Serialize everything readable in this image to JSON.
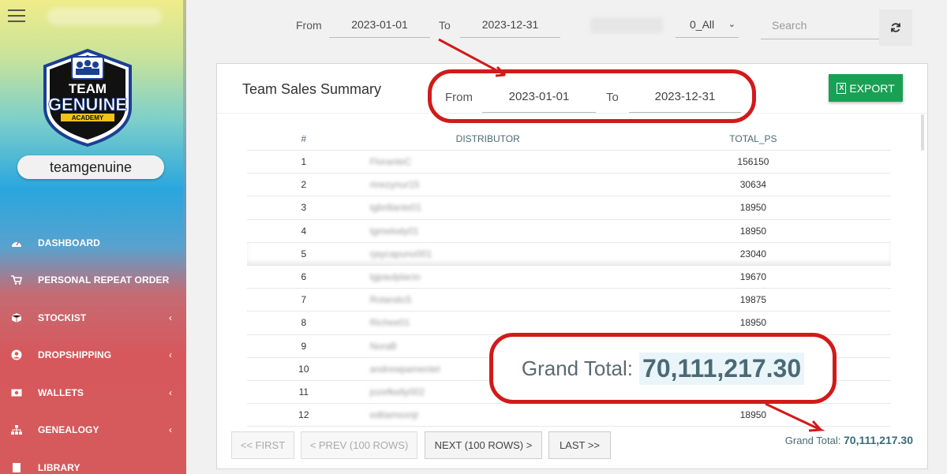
{
  "sidebar": {
    "username": "teamgenuine",
    "logo": {
      "line1": "TEAM",
      "line2": "GENUINE",
      "line3": "ACADEMY"
    },
    "items": [
      {
        "label": "DASHBOARD",
        "icon": "dashboard-icon",
        "caret": ""
      },
      {
        "label": "PERSONAL REPEAT ORDER",
        "icon": "cart-icon",
        "caret": ""
      },
      {
        "label": "STOCKIST",
        "icon": "box-icon",
        "caret": "‹"
      },
      {
        "label": "DROPSHIPPING",
        "icon": "user-circle-icon",
        "caret": "‹"
      },
      {
        "label": "WALLETS",
        "icon": "money-icon",
        "caret": "‹"
      },
      {
        "label": "GENEALOGY",
        "icon": "sitemap-icon",
        "caret": "‹"
      },
      {
        "label": "LIBRARY",
        "icon": "book-icon",
        "caret": ""
      }
    ]
  },
  "filters": {
    "from_label": "From",
    "from_value": "2023-01-01",
    "to_label": "To",
    "to_value": "2023-12-31",
    "select_value": "0_All",
    "search_placeholder": "Search"
  },
  "card": {
    "title": "Team Sales Summary",
    "export_label": "EXPORT",
    "from_label": "From",
    "from_value": "2023-01-01",
    "to_label": "To",
    "to_value": "2023-12-31"
  },
  "table": {
    "headers": [
      "#",
      "DISTRIBUTOR",
      "TOTAL_PS"
    ],
    "rows": [
      {
        "num": "1",
        "name": "FloranteC",
        "total": "156150"
      },
      {
        "num": "2",
        "name": "rinezynur15",
        "total": "30634"
      },
      {
        "num": "3",
        "name": "tgbrillante01",
        "total": "18950"
      },
      {
        "num": "4",
        "name": "tgmelody01",
        "total": "18950"
      },
      {
        "num": "5",
        "name": "rjaycapuno001",
        "total": "23040"
      },
      {
        "num": "6",
        "name": "tgpaulplacio",
        "total": "19670"
      },
      {
        "num": "7",
        "name": "RolandoS",
        "total": "19875"
      },
      {
        "num": "8",
        "name": "Richee01",
        "total": "18950"
      },
      {
        "num": "9",
        "name": "NoraB",
        "total": ""
      },
      {
        "num": "10",
        "name": "andrewpamentel",
        "total": ""
      },
      {
        "num": "11",
        "name": "jozefkelly002",
        "total": ""
      },
      {
        "num": "12",
        "name": "edtiamsonjr",
        "total": "18950"
      }
    ]
  },
  "pagination": {
    "first": "<< FIRST",
    "prev": "< PREV (100 ROWS)",
    "next": "NEXT (100 ROWS) >",
    "last": "LAST >>"
  },
  "grand_total": {
    "label": "Grand Total:",
    "value": "70,111,217.30"
  },
  "colors": {
    "accent_red": "#d11a1a",
    "export_green": "#1aa055",
    "header_teal": "#4a6a73"
  }
}
